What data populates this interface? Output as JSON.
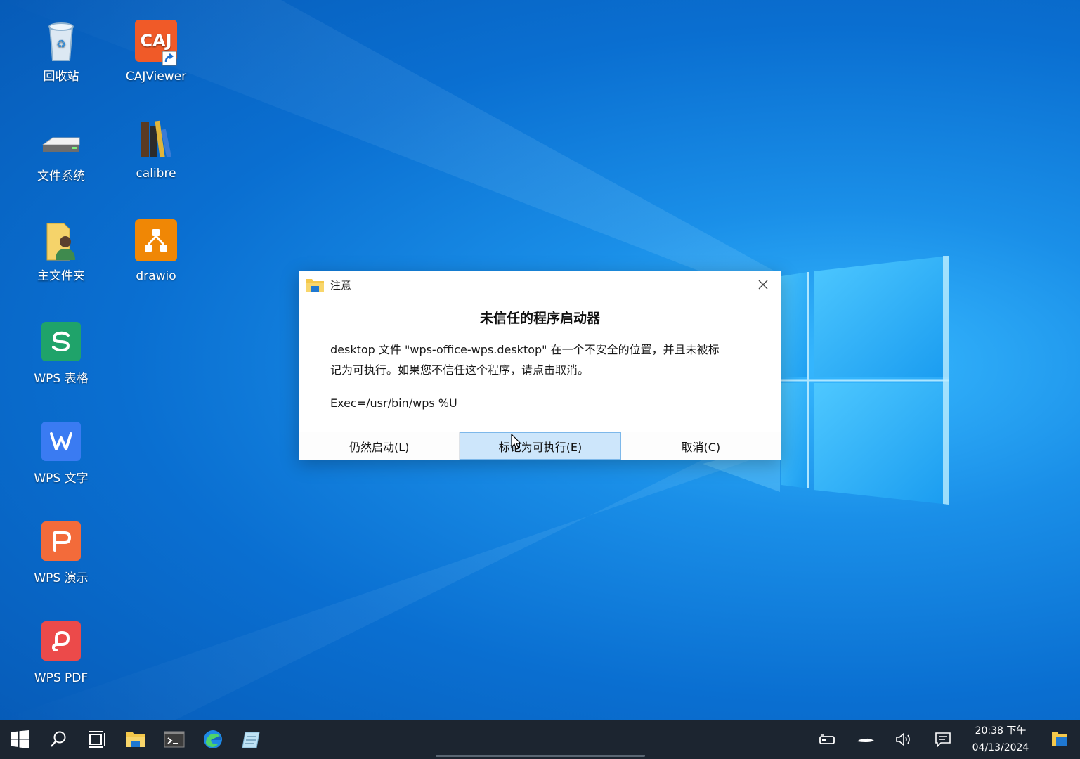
{
  "desktop": {
    "icons": [
      {
        "label": "回收站"
      },
      {
        "label": "CAJViewer",
        "tile_text": "CAJ",
        "color": "#f05a28"
      },
      {
        "label": "文件系统"
      },
      {
        "label": "calibre"
      },
      {
        "label": "主文件夹"
      },
      {
        "label": "drawio",
        "color": "#f08705"
      },
      {
        "label": "WPS 表格",
        "color": "#1fa36a"
      },
      {
        "label": "WPS 文字",
        "color": "#3a7bf2"
      },
      {
        "label": "WPS 演示",
        "color": "#f36b3a"
      },
      {
        "label": "WPS PDF",
        "color": "#ec4a4a"
      }
    ]
  },
  "dialog": {
    "title": "注意",
    "heading": "未信任的程序启动器",
    "message_line1": "desktop 文件 \"wps-office-wps.desktop\" 在一个不安全的位置，并且未被标",
    "message_line2": "记为可执行。如果您不信任这个程序，请点击取消。",
    "exec": "Exec=/usr/bin/wps %U",
    "buttons": {
      "launch": "仍然启动(L)",
      "mark_executable": "标记为可执行(E)",
      "cancel": "取消(C)"
    }
  },
  "taskbar": {
    "clock_time": "20:38 下午",
    "clock_date": "04/13/2024",
    "icons": [
      "start-icon",
      "search-icon",
      "task-view-icon",
      "file-explorer-icon",
      "terminal-icon",
      "edge-icon",
      "notepad-icon"
    ],
    "tray_icons": [
      "network-icon",
      "onedrive-icon",
      "volume-icon",
      "notification-icon",
      "show-desktop-icon"
    ]
  },
  "colors": {
    "taskbar": "#1c2530",
    "button_hover": "#cde6fb",
    "desktop_blue": "#0a6fd1"
  }
}
